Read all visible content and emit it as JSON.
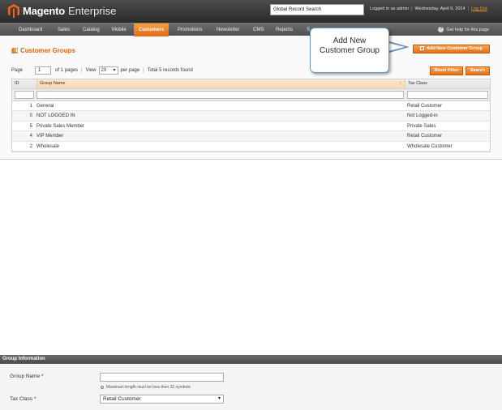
{
  "header": {
    "brand": "Magento",
    "edition": "Enterprise",
    "global_search": "Global Record Search",
    "logged_in": "Logged in as admin",
    "date": "Wednesday, April 9, 2014",
    "logout": "Log Out"
  },
  "nav": {
    "items": [
      "Dashboard",
      "Sales",
      "Catalog",
      "Mobile",
      "Customers",
      "Promotions",
      "Newsletter",
      "CMS",
      "Reports",
      "S"
    ],
    "active": "Customers",
    "help": "Get help for this page"
  },
  "page": {
    "title": "Customer Groups",
    "add_button": "Add New Customer Group",
    "callout": [
      "Add New",
      "Customer Group"
    ]
  },
  "pager": {
    "page_label": "Page",
    "page_value": "1",
    "of_pages": "of 1 pages",
    "view_label": "View",
    "view_value": "20",
    "per_page": "per page",
    "records": "Total 5 records found",
    "reset_filter": "Reset Filter",
    "search": "Search"
  },
  "grid": {
    "columns": [
      "ID",
      "Group Name",
      "Tax Class"
    ],
    "rows": [
      {
        "id": "1",
        "name": "General",
        "tax": "Retail Customer"
      },
      {
        "id": "0",
        "name": "NOT LOGGED IN",
        "tax": "Not Logged-in"
      },
      {
        "id": "5",
        "name": "Private Sales Member",
        "tax": "Private Sales"
      },
      {
        "id": "4",
        "name": "VIP Member",
        "tax": "Retail Customer"
      },
      {
        "id": "2",
        "name": "Wholesale",
        "tax": "Wholesale Customer"
      }
    ]
  },
  "form": {
    "section_title": "Group Information",
    "group_name_label": "Group Name *",
    "note": "Maximum length must be less then 32 symbols",
    "tax_class_label": "Tax Class *",
    "tax_class_value": "Retail Customer"
  },
  "colors": {
    "accent": "#eb5e00",
    "button": "#f08a2c",
    "header_dark": "#2a2a2a",
    "callout_border": "#6b93b8"
  }
}
